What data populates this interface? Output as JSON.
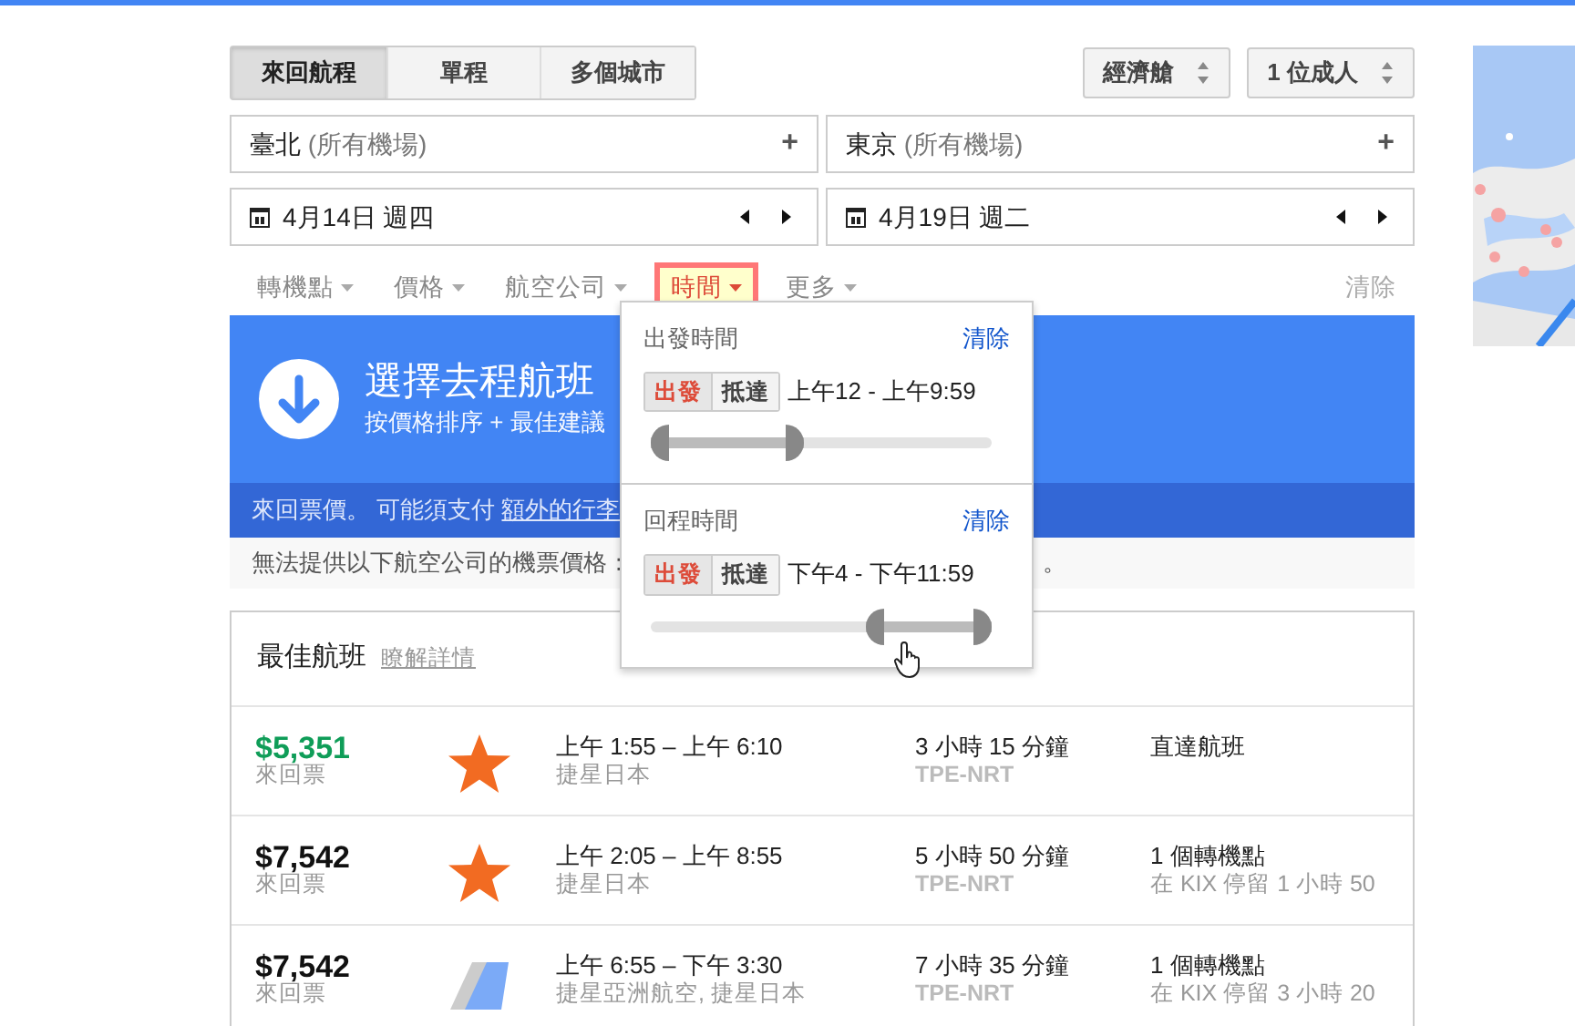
{
  "trip_types": [
    {
      "label": "來回航程",
      "selected": true
    },
    {
      "label": "單程",
      "selected": false
    },
    {
      "label": "多個城市",
      "selected": false
    }
  ],
  "cabin": "經濟艙",
  "passengers": "1 位成人",
  "places": [
    {
      "city": "臺北",
      "detail": "(所有機場)",
      "add": "+"
    },
    {
      "city": "東京",
      "detail": "(所有機場)",
      "add": "+"
    }
  ],
  "dates": [
    {
      "date": "4月14日 週四"
    },
    {
      "date": "4月19日 週二"
    }
  ],
  "filters": [
    {
      "label": "轉機點",
      "active": false
    },
    {
      "label": "價格",
      "active": false
    },
    {
      "label": "航空公司",
      "active": false
    },
    {
      "label": "時間",
      "active": true
    },
    {
      "label": "更多",
      "active": false
    }
  ],
  "filters_clear": "清除",
  "banner": {
    "title": "選擇去程航班",
    "subtitle": "按價格排序 + 最佳建議"
  },
  "note": {
    "text": "來回票價。 可能須支付",
    "link": "額外的行李"
  },
  "notice": {
    "text": "無法提供以下航空公司的機票價格：",
    "tail": "。"
  },
  "time_popover": {
    "sections": [
      {
        "title": "出發時間",
        "clear": "清除",
        "toggle": [
          {
            "label": "出發",
            "selected": true
          },
          {
            "label": "抵達",
            "selected": false
          }
        ],
        "range_text": "上午12 - 上午9:59",
        "thumbs": [
          {
            "level": 0
          },
          {
            "level": 0.45
          }
        ]
      },
      {
        "title": "回程時間",
        "clear": "清除",
        "toggle": [
          {
            "label": "出發",
            "selected": true
          },
          {
            "label": "抵達",
            "selected": false
          }
        ],
        "range_text": "下午4 - 下午11:59",
        "thumbs": [
          {
            "level": 0.63
          },
          {
            "level": 1
          }
        ]
      }
    ]
  },
  "results": {
    "title": "最佳航班",
    "link": "瞭解詳情",
    "flights": [
      {
        "price": "$5,351",
        "cheapest": true,
        "price_note": "來回票",
        "kind": "star",
        "times": "上午 1:55 – 上午 6:10",
        "airline": "捷星日本",
        "duration": "3 小時 15 分鐘",
        "route": "TPE-NRT",
        "stops": "直達航班"
      },
      {
        "price": "$7,542",
        "cheapest": false,
        "price_note": "來回票",
        "kind": "star",
        "times": "上午 2:05 – 上午 8:55",
        "airline": "捷星日本",
        "duration": "5 小時 50 分鐘",
        "route": "TPE-NRT",
        "stops": "1 個轉機點",
        "stop_detail": "在 KIX 停留 1 小時 50"
      },
      {
        "price": "$7,542",
        "cheapest": false,
        "price_note": "來回票",
        "kind": "tail",
        "times": "上午 6:55 – 下午 3:30",
        "airline": "捷星亞洲航空, 捷星日本",
        "duration": "7 小時 35 分鐘",
        "route": "TPE-NRT",
        "stops": "1 個轉機點",
        "stop_detail": "在 KIX 停留 3 小時 20"
      }
    ]
  }
}
